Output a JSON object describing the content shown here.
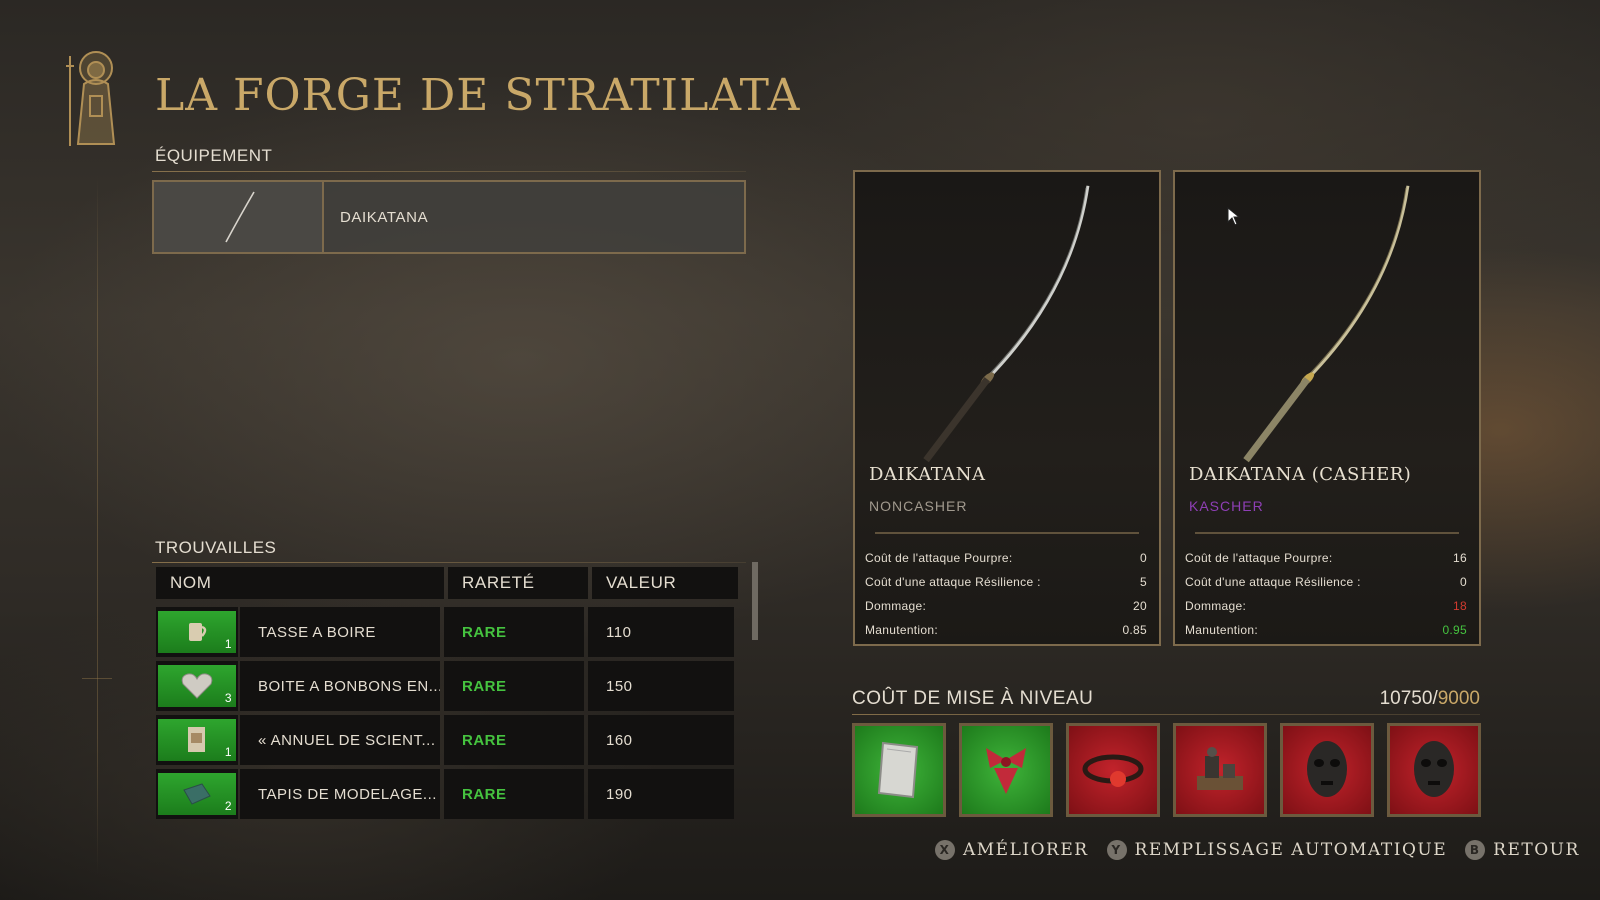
{
  "header": {
    "title": "LA FORGE DE STRATILATA"
  },
  "equipment": {
    "section_label": "ÉQUIPEMENT",
    "item_name": "DAIKATANA"
  },
  "finds": {
    "section_label": "TROUVAILLES",
    "columns": [
      "NOM",
      "RARETÉ",
      "VALEUR"
    ],
    "rows": [
      {
        "icon": "mug-icon",
        "count": "1",
        "name": "TASSE A BOIRE",
        "rarity": "RARE",
        "value": "110"
      },
      {
        "icon": "heart-candy-box-icon",
        "count": "3",
        "name": "BOITE A BONBONS EN...",
        "rarity": "RARE",
        "value": "150"
      },
      {
        "icon": "book-icon",
        "count": "1",
        "name": "« ANNUEL DE SCIENT...",
        "rarity": "RARE",
        "value": "160"
      },
      {
        "icon": "modeling-mat-icon",
        "count": "2",
        "name": "TAPIS DE MODELAGE...",
        "rarity": "RARE",
        "value": "190"
      }
    ]
  },
  "comparison": {
    "current": {
      "name": "DAIKATANA",
      "type": "NONCASHER",
      "type_color": "#a19a8e",
      "stats": [
        {
          "label": "Coût de l'attaque Pourpre:",
          "value": "0",
          "color": "#e4ddd0"
        },
        {
          "label": "Coût d'une attaque Résilience :",
          "value": "5",
          "color": "#e4ddd0"
        },
        {
          "label": "Dommage:",
          "value": "20",
          "color": "#e4ddd0"
        },
        {
          "label": "Manutention:",
          "value": "0.85",
          "color": "#e4ddd0"
        }
      ]
    },
    "upgraded": {
      "name": "DAIKATANA (CASHER)",
      "type": "KASCHER",
      "type_color": "#8e3fb5",
      "stats": [
        {
          "label": "Coût de l'attaque Pourpre:",
          "value": "16",
          "color": "#e4ddd0"
        },
        {
          "label": "Coût d'une attaque Résilience :",
          "value": "0",
          "color": "#e4ddd0"
        },
        {
          "label": "Dommage:",
          "value": "18",
          "color": "#d23b2f"
        },
        {
          "label": "Manutention:",
          "value": "0.95",
          "color": "#45c33f"
        }
      ]
    }
  },
  "upgrade_cost": {
    "label": "COÛT DE MISE À NIVEAU",
    "current": "10750",
    "separator": "/",
    "required": "9000",
    "required_color": "#c9a868",
    "materials": [
      {
        "icon": "silver-plate-icon",
        "status": "available"
      },
      {
        "icon": "red-ribbon-icon",
        "status": "available"
      },
      {
        "icon": "ball-gag-icon",
        "status": "missing"
      },
      {
        "icon": "machine-parts-icon",
        "status": "missing"
      },
      {
        "icon": "leather-mask-icon",
        "status": "missing"
      },
      {
        "icon": "leather-mask-icon",
        "status": "missing"
      }
    ]
  },
  "actions": [
    {
      "glyph": "X",
      "label": "AMÉLIORER",
      "icon": "x-button-icon"
    },
    {
      "glyph": "Y",
      "label": "REMPLISSAGE AUTOMATIQUE",
      "icon": "y-button-icon"
    },
    {
      "glyph": "B",
      "label": "RETOUR",
      "icon": "b-button-icon"
    }
  ]
}
